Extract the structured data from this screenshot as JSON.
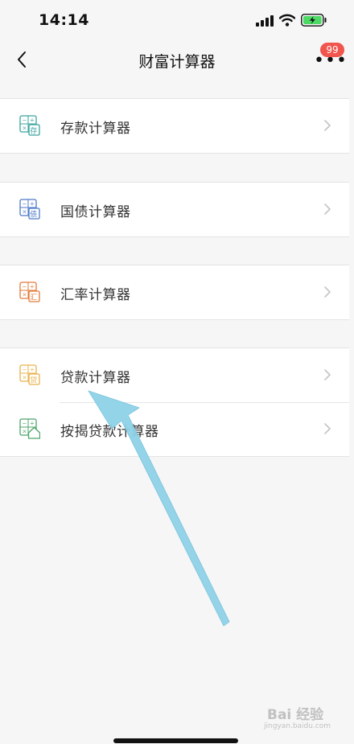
{
  "status_bar": {
    "time": "14:14"
  },
  "nav": {
    "title": "财富计算器",
    "more_badge": "99"
  },
  "colors": {
    "deposit": "#3aa3a0",
    "bond": "#4d7ac8",
    "exchange": "#e37a3a",
    "loan": "#e8b24a",
    "mortgage": "#4ea56a",
    "arrow": "#8fd2e8",
    "badge": "#f0554e"
  },
  "groups": [
    {
      "items": [
        {
          "label": "存款计算器",
          "icon": "deposit-calculator-icon",
          "icon_char": "存"
        }
      ]
    },
    {
      "items": [
        {
          "label": "国债计算器",
          "icon": "bond-calculator-icon",
          "icon_char": "债"
        }
      ]
    },
    {
      "items": [
        {
          "label": "汇率计算器",
          "icon": "exchange-calculator-icon",
          "icon_char": "汇"
        }
      ]
    },
    {
      "items": [
        {
          "label": "贷款计算器",
          "icon": "loan-calculator-icon",
          "icon_char": "贷"
        },
        {
          "label": "按揭贷款计算器",
          "icon": "mortgage-calculator-icon",
          "icon_char": ""
        }
      ]
    }
  ],
  "watermark": {
    "text": "Bai 经验",
    "sub": "jingyan.baidu.com"
  }
}
